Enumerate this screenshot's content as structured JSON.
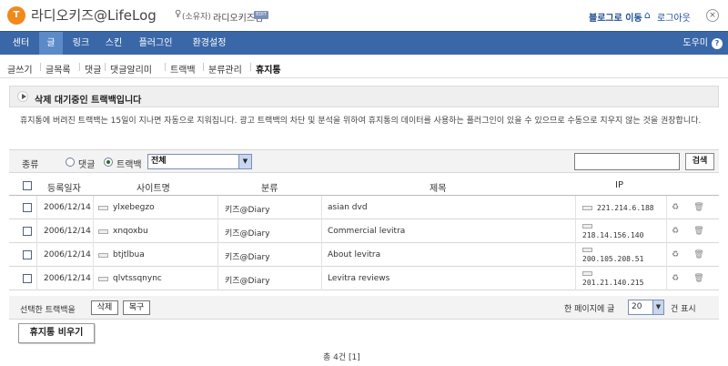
{
  "header": {
    "logo_glyph": "T",
    "brand": "라디오키즈@LifeLog",
    "owner_label": "(소유자)",
    "user_name": "라디오키즈님",
    "edit_badge": "EDIT",
    "go_to_blog": "블로그로 이동",
    "logout": "로그아웃"
  },
  "main_nav": {
    "items": [
      "센터",
      "글",
      "링크",
      "스킨",
      "플러그인",
      "환경설정"
    ],
    "active": "글",
    "help": "도우미"
  },
  "sub_nav": {
    "items": [
      "글쓰기",
      "글목록",
      "댓글",
      "댓글알리미",
      "트랙백",
      "분류관리",
      "휴지통"
    ],
    "active": "휴지통"
  },
  "section_title": "삭제 대기중인 트랙백입니다",
  "description": "휴지통에 버려진 트랙백는 15일이 지나면 자동으로 지워집니다. 광고 트랙백의 차단 및 분석을 위하여 휴지통의 데이터를 사용하는 플러그인이 있을 수 있으므로 수동으로 지우지 않는 것을 권장합니다.",
  "filter": {
    "kind_label": "종류",
    "option_comment": "댓글",
    "option_trackback": "트랙백",
    "selected_option": "트랙백",
    "category_value": "전체",
    "search_value": "",
    "search_button": "검색"
  },
  "table": {
    "headers": [
      "등록일자",
      "사이트명",
      "분류",
      "제목",
      "IP"
    ],
    "rows": [
      {
        "date": "2006/12/14",
        "site": "ylxebegzo",
        "category": "키즈@Diary",
        "title": "asian dvd",
        "ip": "221.214.6.188"
      },
      {
        "date": "2006/12/14",
        "site": "xnqoxbu",
        "category": "키즈@Diary",
        "title": "Commercial levitra",
        "ip": "218.14.156.140"
      },
      {
        "date": "2006/12/14",
        "site": "btjtlbua",
        "category": "키즈@Diary",
        "title": "About levitra",
        "ip": "200.105.208.51"
      },
      {
        "date": "2006/12/14",
        "site": "qlvtssqnync",
        "category": "키즈@Diary",
        "title": "Levitra reviews",
        "ip": "201.21.140.215"
      }
    ]
  },
  "footer": {
    "selected_label": "선택한 트랙백을",
    "delete_button": "삭제",
    "restore_button": "복구",
    "per_page_label": "한 페이지에 글",
    "per_page_value": "20",
    "per_page_suffix": "건 표시",
    "empty_trash_button": "휴지통 비우기",
    "total": "총 4건 [1]"
  }
}
